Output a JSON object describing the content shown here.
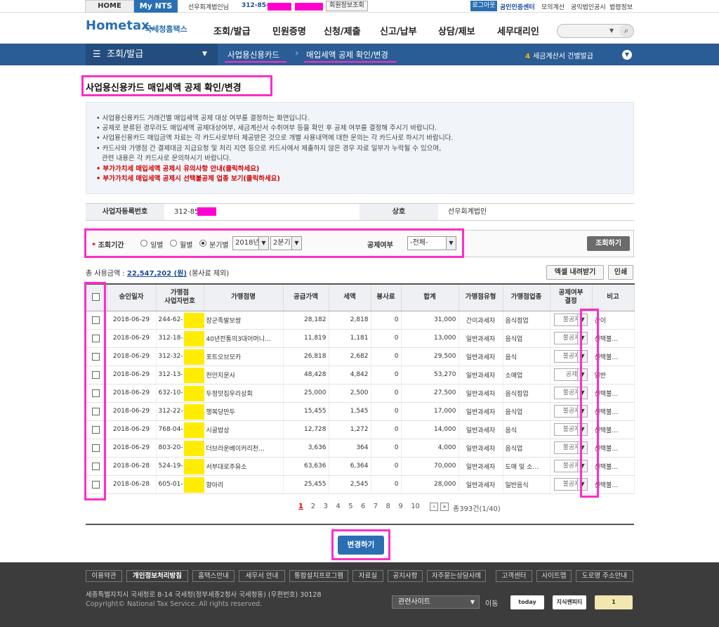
{
  "topbar": {
    "home": "HOME",
    "mynts": "My NTS",
    "user": "선우회계법인님",
    "biz_prefix": "312-85-",
    "member_info": "회원정보조회",
    "logout": "로그아웃",
    "cert": "공인인증센터",
    "mock_tax": "모의계산",
    "corp_notice": "공익법인공시",
    "law_info": "법령정보"
  },
  "header": {
    "logo": "Hometax.",
    "logo_sub": "국세청홈택스",
    "nav": [
      "조회/발급",
      "민원증명",
      "신청/제출",
      "신고/납부",
      "상담/제보",
      "세무대리인"
    ],
    "search_placeholder": ""
  },
  "subnav": {
    "menu": "조회/발급",
    "crumb1": "사업용신용카드",
    "crumb2": "매입세액 공제 확인/변경",
    "notice_num": "4",
    "notice_text": "세금계산서 건별발급"
  },
  "page": {
    "title": "사업용신용카드 매입세액 공제 확인/변경",
    "info": [
      "사업용신용카드 거래건별 매입세액 공제 대상 여부를 결정하는 화면입니다.",
      "공제로 분류된 경우라도 매입세액 공제대상여부, 세금계산서 수취여부 등을 확인 후 공제 여부를 결정해 주시기 바랍니다.",
      "사업용신용카드 매입금액 자료는 각 카드사로부터 제공받은 것으로 개별 사용내역에 대한 문의는 각 카드사로 하시기 바랍니다.",
      "카드사와 가맹점 간 결제대금 지급요청 및 처리 지연 등으로 카드사에서 제출하지 않은 경우 자료 일부가 누락될 수 있으며,",
      "관련 내용은 각 카드사로 문의하시기 바랍니다."
    ],
    "info_link1": "부가가치세 매입세액 공제시 유의사항 안내(클릭하세요)",
    "info_link2": "부가가치세 매입세액 공제시 선택불공제 업종 보기(클릭하세요)"
  },
  "biz": {
    "label_no": "사업자등록번호",
    "value_no": "312-85-",
    "label_name": "상호",
    "value_name": "선우회계법인"
  },
  "search": {
    "period_label": "조회기간",
    "opt_daily": "일별",
    "opt_monthly": "월별",
    "opt_quarter": "분기별",
    "year": "2018년",
    "quarter": "2분기",
    "deduct_label": "공제여부",
    "deduct_value": "-전체-",
    "query_btn": "조회하기"
  },
  "total": {
    "label": "총 사용금액 :",
    "amount": "22,547,202 (원)",
    "note": "(봉사료 제외)",
    "excel_btn": "엑셀 내려받기",
    "print_btn": "인쇄"
  },
  "table": {
    "headers": [
      "승인일자",
      "가맹점\n사업자번호",
      "가맹점명",
      "공급가액",
      "세액",
      "봉사료",
      "합계",
      "가맹점유형",
      "가맹점업종",
      "공제여부\n결정",
      "비고"
    ],
    "rows": [
      {
        "date": "2018-06-29",
        "bizno": "244-62-",
        "name": "장군족발보쌈",
        "supply": "28,182",
        "tax": "2,818",
        "svc": "0",
        "total": "31,000",
        "type": "간이과세자",
        "cat": "음식점업",
        "deduct": "불공제",
        "note": "간이"
      },
      {
        "date": "2018-06-29",
        "bizno": "312-18-",
        "name": "40년전통의3대어머니…",
        "supply": "11,819",
        "tax": "1,181",
        "svc": "0",
        "total": "13,000",
        "type": "일반과세자",
        "cat": "음식업",
        "deduct": "불공제",
        "note": "선택불…"
      },
      {
        "date": "2018-06-29",
        "bizno": "312-32-",
        "name": "포트오브모카",
        "supply": "26,818",
        "tax": "2,682",
        "svc": "0",
        "total": "29,500",
        "type": "일반과세자",
        "cat": "음식",
        "deduct": "불공제",
        "note": "선택불…"
      },
      {
        "date": "2018-06-29",
        "bizno": "312-13-",
        "name": "천안지문사",
        "supply": "48,428",
        "tax": "4,842",
        "svc": "0",
        "total": "53,270",
        "type": "일반과세자",
        "cat": "소매업",
        "deduct": "공제",
        "note": "일반"
      },
      {
        "date": "2018-06-29",
        "bizno": "632-10-",
        "name": "두정맛집우리상회",
        "supply": "25,000",
        "tax": "2,500",
        "svc": "0",
        "total": "27,500",
        "type": "일반과세자",
        "cat": "음식점업",
        "deduct": "불공제",
        "note": "선택불…"
      },
      {
        "date": "2018-06-29",
        "bizno": "312-22-",
        "name": "행복당만두",
        "supply": "15,455",
        "tax": "1,545",
        "svc": "0",
        "total": "17,000",
        "type": "일반과세자",
        "cat": "음식업",
        "deduct": "불공제",
        "note": "선택불…"
      },
      {
        "date": "2018-06-29",
        "bizno": "768-04-",
        "name": "시골밥상",
        "supply": "12,728",
        "tax": "1,272",
        "svc": "0",
        "total": "14,000",
        "type": "일반과세자",
        "cat": "음식",
        "deduct": "불공제",
        "note": "선택불…"
      },
      {
        "date": "2018-06-29",
        "bizno": "803-20-",
        "name": "더브라운베이커리천…",
        "supply": "3,636",
        "tax": "364",
        "svc": "0",
        "total": "4,000",
        "type": "일반과세자",
        "cat": "음식업",
        "deduct": "불공제",
        "note": "선택불…"
      },
      {
        "date": "2018-06-28",
        "bizno": "524-19-",
        "name": "서부대로주유소",
        "supply": "63,636",
        "tax": "6,364",
        "svc": "0",
        "total": "70,000",
        "type": "일반과세자",
        "cat": "도매 및 소…",
        "deduct": "불공제",
        "note": "선택불…"
      },
      {
        "date": "2018-06-28",
        "bizno": "605-01-",
        "name": "향아리",
        "supply": "25,455",
        "tax": "2,545",
        "svc": "0",
        "total": "28,000",
        "type": "일반과세자",
        "cat": "일반음식",
        "deduct": "불공제",
        "note": "선택불…"
      }
    ]
  },
  "pager": {
    "pages": [
      "1",
      "2",
      "3",
      "4",
      "5",
      "6",
      "7",
      "8",
      "9",
      "10"
    ],
    "count": "총393건(1/40)"
  },
  "change_btn": "변경하기",
  "footer": {
    "links": [
      "이용약관",
      "개인정보처리방침",
      "홈택스안내",
      "세무서 안내",
      "통합설치프로그램",
      "자료실",
      "공지사항",
      "자주묻는상담사례",
      "고객센터",
      "사이트맵",
      "도로명 주소안내"
    ],
    "address": "세종특별자치시 국세청로 8-14 국세청(정부세종2청사 국세청동) (우편번호) 30128",
    "copyright": "Copyright© National Tax Service. All rights reserved.",
    "related": "관련사이트",
    "go": "이동",
    "banner1": "today",
    "banner2": "지식쌘피티",
    "banner3": "1"
  }
}
